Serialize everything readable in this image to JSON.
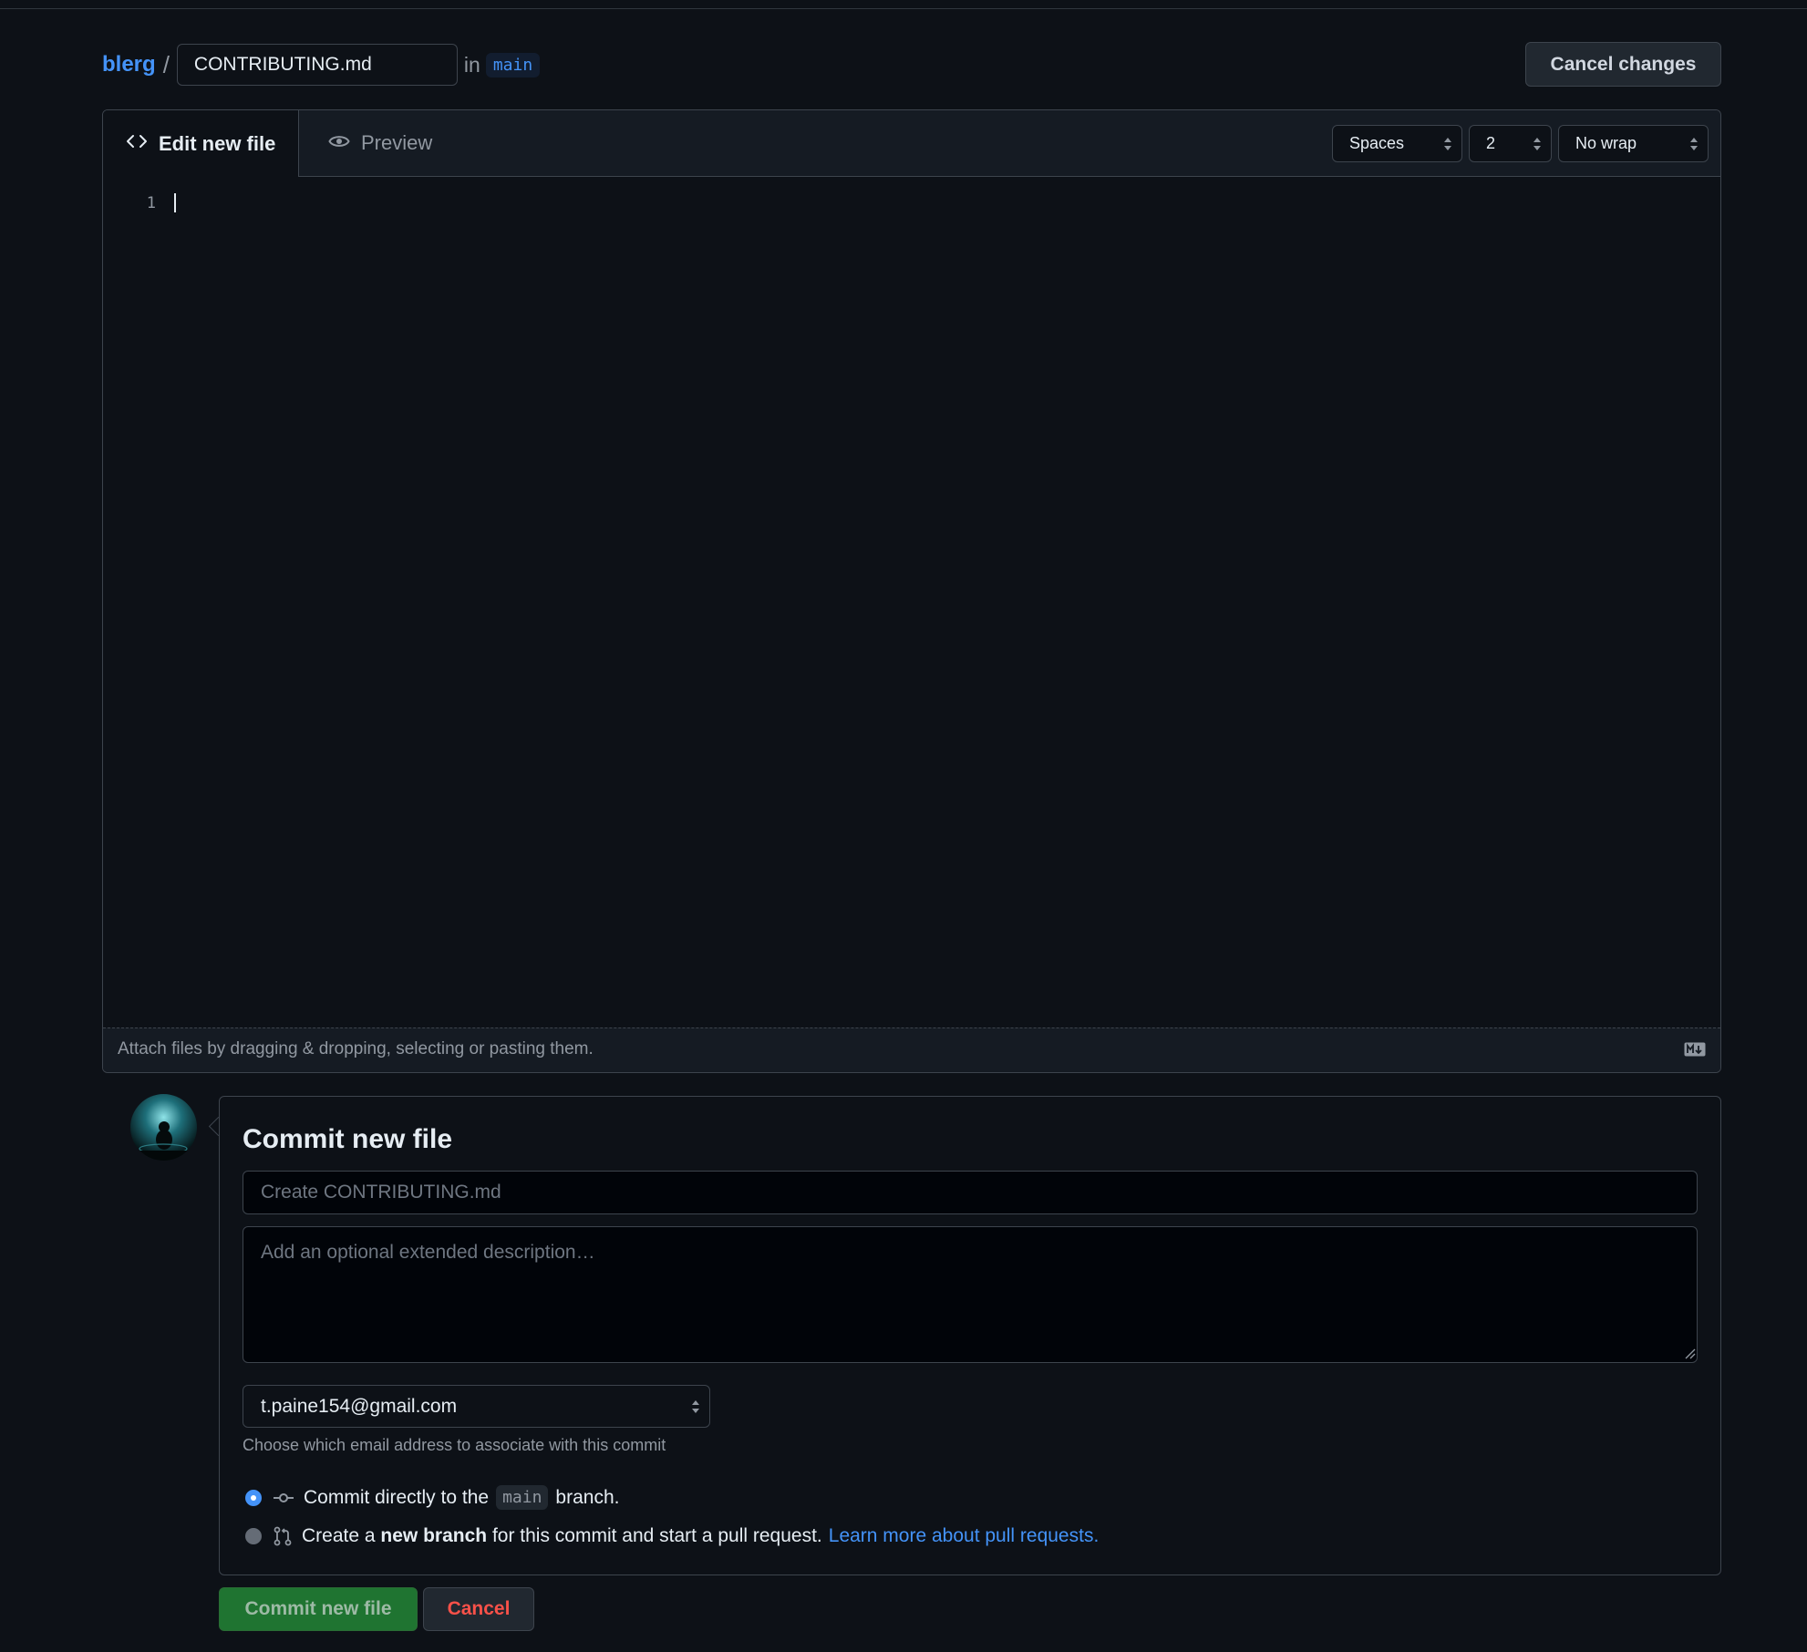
{
  "breadcrumb": {
    "repo": "blerg",
    "separator": "/",
    "filename": "CONTRIBUTING.md",
    "in_label": "in",
    "branch": "main"
  },
  "header": {
    "cancel_changes": "Cancel changes"
  },
  "editor": {
    "tabs": {
      "edit": "Edit new file",
      "preview": "Preview"
    },
    "indent_mode": "Spaces",
    "indent_size": "2",
    "wrap_mode": "No wrap",
    "line_numbers": [
      "1"
    ],
    "attach_hint": "Attach files by dragging & dropping, selecting or pasting them."
  },
  "commit": {
    "title": "Commit new file",
    "message_placeholder": "Create CONTRIBUTING.md",
    "description_placeholder": "Add an optional extended description…",
    "email": "t.paine154@gmail.com",
    "email_help": "Choose which email address to associate with this commit",
    "option_direct": {
      "prefix": "Commit directly to the",
      "branch": "main",
      "suffix": "branch.",
      "selected": true
    },
    "option_new_branch": {
      "prefix": "Create a",
      "bold": "new branch",
      "suffix": "for this commit and start a pull request.",
      "link": "Learn more about pull requests.",
      "selected": false
    },
    "submit_label": "Commit new file",
    "cancel_label": "Cancel"
  },
  "icons": {
    "edit_tab": "code-icon",
    "preview_tab": "eye-icon",
    "markdown": "markdown-icon",
    "commit_direct": "git-commit-icon",
    "commit_branch": "git-pull-request-icon"
  },
  "colors": {
    "background": "#0d1117",
    "accent": "#4493f8",
    "commit_button": "#238636",
    "danger": "#f85149"
  }
}
